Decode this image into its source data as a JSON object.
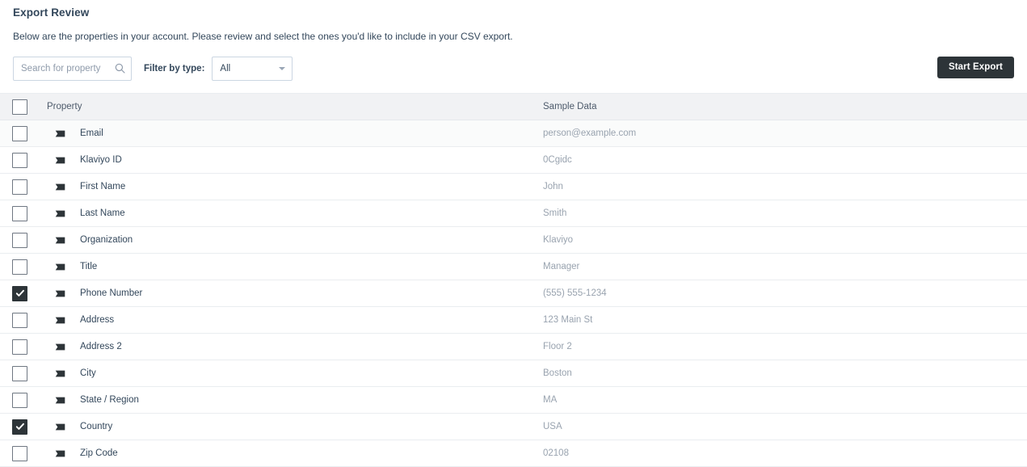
{
  "page": {
    "title": "Export Review",
    "subtitle": "Below are the properties in your account. Please review and select the ones you'd like to include in your CSV export."
  },
  "toolbar": {
    "search_placeholder": "Search for property",
    "search_value": "",
    "search_icon": "search-icon",
    "filter_label": "Filter by type:",
    "filter_value": "All",
    "filter_caret_icon": "chevron-down-icon",
    "start_export_label": "Start Export"
  },
  "colors": {
    "accent": "#2d3438",
    "header_bg": "#f1f2f4",
    "row_tint": "#fafbfb",
    "border": "#eaedf0",
    "text": "#33475b",
    "muted_text": "#99a3af",
    "checkbox_border": "#6f7782"
  },
  "table": {
    "columns": {
      "select_all": "",
      "property": "Property",
      "sample_data": "Sample Data"
    },
    "header_checkbox_checked": false,
    "row_icon": "property-tag-icon",
    "rows": [
      {
        "property": "Email",
        "sample": "person@example.com",
        "checked": false,
        "tinted": true
      },
      {
        "property": "Klaviyo ID",
        "sample": "0Cgidc",
        "checked": false,
        "tinted": false
      },
      {
        "property": "First Name",
        "sample": "John",
        "checked": false,
        "tinted": false
      },
      {
        "property": "Last Name",
        "sample": "Smith",
        "checked": false,
        "tinted": false
      },
      {
        "property": "Organization",
        "sample": "Klaviyo",
        "checked": false,
        "tinted": false
      },
      {
        "property": "Title",
        "sample": "Manager",
        "checked": false,
        "tinted": false
      },
      {
        "property": "Phone Number",
        "sample": "(555) 555-1234",
        "checked": true,
        "tinted": false
      },
      {
        "property": "Address",
        "sample": "123 Main St",
        "checked": false,
        "tinted": false
      },
      {
        "property": "Address 2",
        "sample": "Floor 2",
        "checked": false,
        "tinted": false
      },
      {
        "property": "City",
        "sample": "Boston",
        "checked": false,
        "tinted": false
      },
      {
        "property": "State / Region",
        "sample": "MA",
        "checked": false,
        "tinted": false
      },
      {
        "property": "Country",
        "sample": "USA",
        "checked": true,
        "tinted": false
      },
      {
        "property": "Zip Code",
        "sample": "02108",
        "checked": false,
        "tinted": false
      }
    ]
  }
}
